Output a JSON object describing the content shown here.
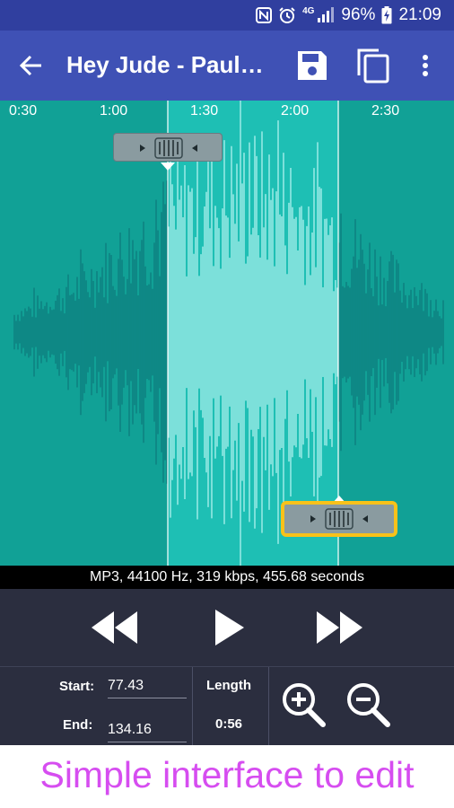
{
  "status_bar": {
    "battery": "96%",
    "time": "21:09",
    "network": "4G",
    "icons": [
      "nfc-icon",
      "alarm-icon",
      "signal-icon",
      "battery-charging-icon"
    ]
  },
  "app_bar": {
    "title": "Hey Jude - Paul McCartney",
    "icons": [
      "back-arrow-icon",
      "save-icon",
      "copy-icon",
      "more-vert-icon"
    ]
  },
  "timeline": {
    "ticks": [
      "0:30",
      "1:00",
      "1:30",
      "2:00",
      "2:30"
    ]
  },
  "waveform": {
    "colors": {
      "background": "#11a196",
      "wave": "#0b6f74",
      "selected_background": "#1ebfb4",
      "selected_wave": "#d6ffff"
    },
    "selection_start_fraction": 0.37,
    "selection_end_fraction": 0.745
  },
  "file_info": "MP3, 44100 Hz, 319 kbps, 455.68 seconds",
  "playback": {
    "icons": [
      "rewind-icon",
      "play-icon",
      "fast-forward-icon"
    ]
  },
  "fields": {
    "start_label": "Start:",
    "start_value": "77.43",
    "end_label": "End:",
    "end_value": "134.16",
    "length_label": "Length",
    "length_value": "0:56"
  },
  "zoom": {
    "icons": [
      "zoom-in-icon",
      "zoom-out-icon"
    ]
  },
  "caption": "Simple interface to edit",
  "colors": {
    "status_bar": "#303f9f",
    "app_bar": "#3f51b5",
    "controls_bg": "#2b2e3f",
    "caption_text": "#d64df0",
    "active_handle_border": "#f8c21a"
  }
}
